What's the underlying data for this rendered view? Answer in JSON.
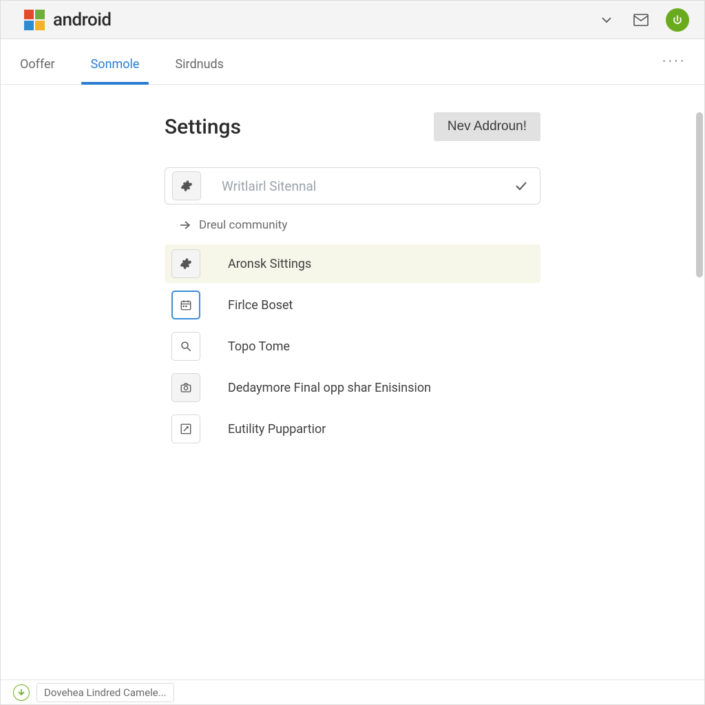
{
  "header": {
    "brand": "android"
  },
  "logo_colors": {
    "tl": "#e14a2b",
    "tr": "#6fae3a",
    "bl": "#2f8bd0",
    "br": "#f3b328"
  },
  "tabs": {
    "items": [
      "Ooffer",
      "Sonmole",
      "Sirdnuds"
    ],
    "more": "····"
  },
  "main": {
    "title": "Settings",
    "new_button": "Nev Addroun!",
    "select_placeholder": "Writlairl Sitennal",
    "community_link": "Dreul community",
    "items": [
      {
        "label": "Aronsk Sittings",
        "icon": "gear",
        "highlight": true
      },
      {
        "label": "Firlce Boset",
        "icon": "calendar",
        "selected": true
      },
      {
        "label": "Topo Tome",
        "icon": "search"
      },
      {
        "label": "Dedaymore Final opp shar Enisinsion",
        "icon": "camera"
      },
      {
        "label": "Eutility Puppartior",
        "icon": "edit"
      }
    ]
  },
  "footer": {
    "text": "Dovehea Lindred Camele..."
  }
}
